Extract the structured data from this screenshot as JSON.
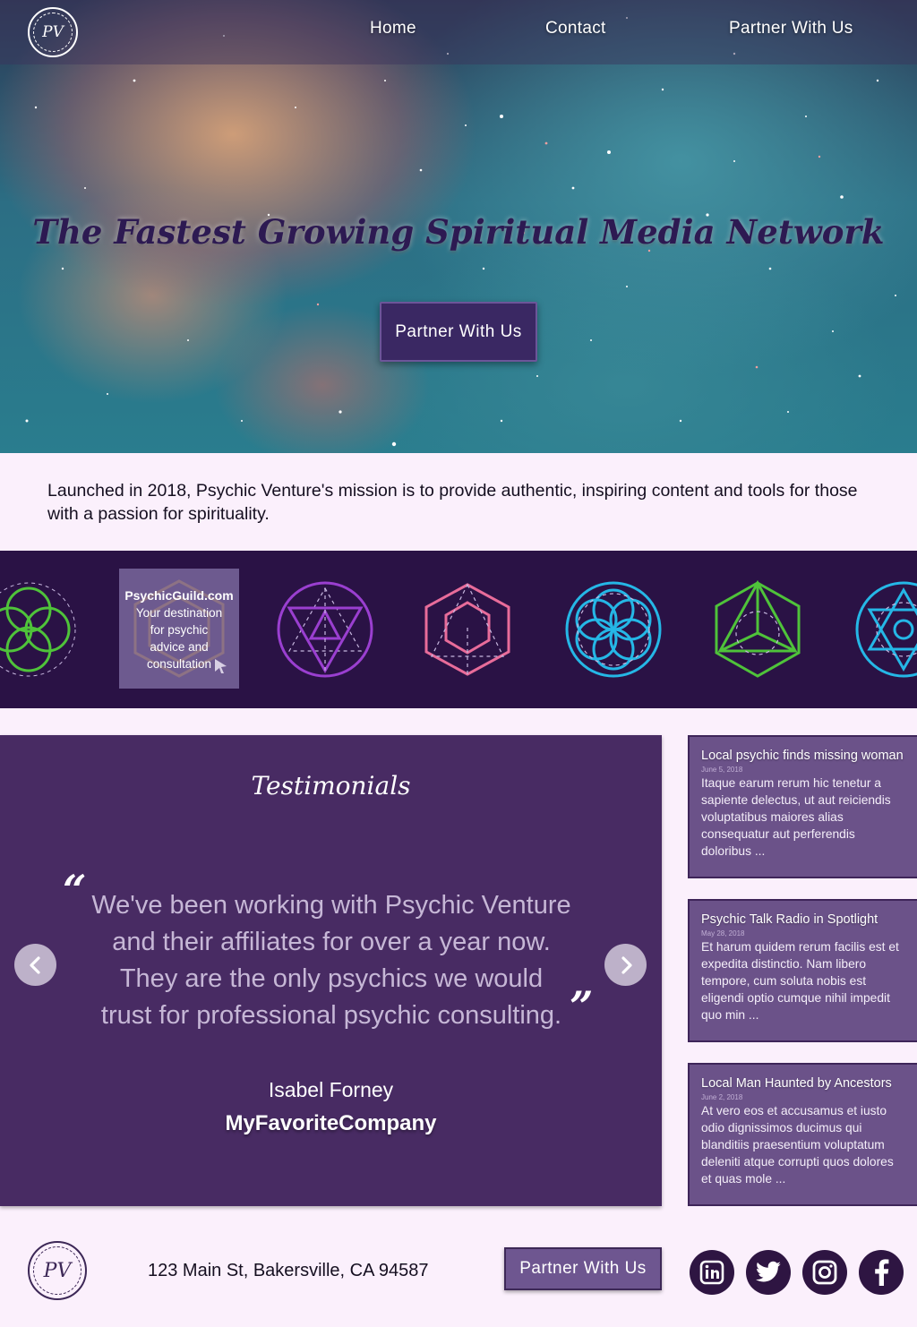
{
  "nav": {
    "logo_text": "PV",
    "links": [
      "Home",
      "Contact",
      "Partner With Us"
    ]
  },
  "hero": {
    "title": "The Fastest Growing Spiritual Media Network",
    "cta_label": "Partner With Us"
  },
  "mission": {
    "text": "Launched in 2018, Psychic Venture's mission is to provide authentic, inspiring content and tools for those with a passion for spirituality."
  },
  "symbols": {
    "icons": [
      "flower-of-life-icon",
      "metatron-star-icon",
      "cube-hexagon-icon",
      "seed-of-life-icon",
      "tetrahedron-icon",
      "hexagram-icon"
    ],
    "colors": [
      "#4fc33a",
      "#9a3fd0",
      "#e86c9a",
      "#25b7e6",
      "#4fc33a",
      "#25b7e6"
    ],
    "featured": {
      "title": "PsychicGuild.com",
      "description_lines": [
        "Your destination",
        "for psychic",
        "advice and",
        "consultation"
      ]
    }
  },
  "testimonials": {
    "heading": "Testimonials",
    "quote_lines": [
      "We've been working with Psychic Venture",
      "and their affiliates for over a year now.",
      "They are the only psychics we would",
      "trust for professional psychic consulting."
    ],
    "author": "Isabel Forney",
    "company": "MyFavoriteCompany"
  },
  "news": [
    {
      "title": "Local psychic finds missing woman",
      "date": "June 5, 2018",
      "excerpt": "Itaque earum rerum hic tenetur a sapiente delectus, ut aut reiciendis voluptatibus maiores alias consequatur aut perferendis doloribus ..."
    },
    {
      "title": "Psychic Talk Radio in Spotlight",
      "date": "May 28, 2018",
      "excerpt": "Et harum quidem rerum facilis est et expedita distinctio. Nam libero tempore, cum soluta nobis est eligendi optio cumque nihil impedit quo min ..."
    },
    {
      "title": "Local Man Haunted by Ancestors",
      "date": "June 2, 2018",
      "excerpt": "At vero eos et accusamus et iusto odio dignissimos ducimus qui blanditiis praesentium voluptatum deleniti atque corrupti quos dolores et quas mole ..."
    }
  ],
  "footer": {
    "logo_text": "PV",
    "address": "123 Main St, Bakersville, CA 94587",
    "cta_label": "Partner With Us",
    "social": [
      "linkedin-icon",
      "twitter-icon",
      "instagram-icon",
      "facebook-icon"
    ]
  }
}
